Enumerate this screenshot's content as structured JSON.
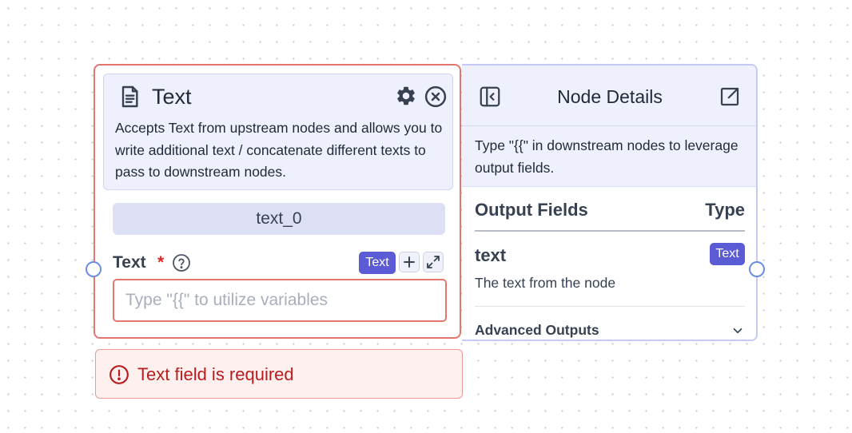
{
  "node": {
    "title": "Text",
    "icon": "document-text-icon",
    "description": "Accepts Text from upstream nodes and allows you to write additional text / concatenate different texts to pass to downstream nodes.",
    "name": "text_0",
    "field": {
      "label": "Text",
      "required_marker": "*",
      "type_badge": "Text",
      "placeholder": "Type \"{{\" to utilize variables",
      "value": ""
    },
    "error": "Text field is required",
    "colors": {
      "error_border": "#e5766f",
      "accent": "#5b5bd6",
      "header_bg": "#eef1fd"
    }
  },
  "details_panel": {
    "title": "Node Details",
    "hint": "Type \"{{\" in downstream nodes to leverage output fields.",
    "columns": {
      "output": "Output Fields",
      "type": "Type"
    },
    "fields": [
      {
        "name": "text",
        "type": "Text",
        "description": "The text from the node"
      }
    ],
    "advanced_label": "Advanced Outputs"
  }
}
